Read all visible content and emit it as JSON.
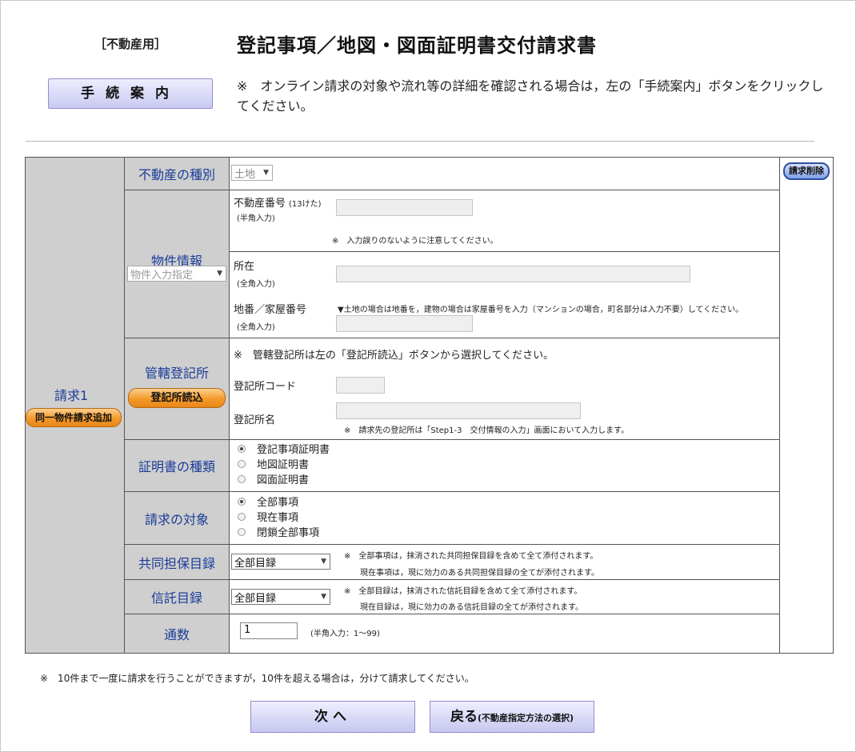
{
  "header": {
    "tag": "［不動産用］",
    "title": "登記事項／地図・図面証明書交付請求書",
    "guide_button": "手続案内",
    "guide_note": "※　オンライン請求の対象や流れ等の詳細を確認される場合は，左の「手続案内」ボタンをクリックしてください。"
  },
  "request": {
    "label": "請求1",
    "add_same_button": "同一物件請求追加",
    "delete_button": "請求削除"
  },
  "property_type": {
    "label": "不動産の種別",
    "selected": "土地"
  },
  "property_info": {
    "label": "物件情報",
    "mode_selected": "物件入力指定",
    "number_label": "不動産番号",
    "number_hint": "(13けた)",
    "number_sub": "(半角入力)",
    "number_value": "",
    "number_note": "※　入力誤りのないように注意してください。",
    "location_label": "所在",
    "location_sub": "(全角入力)",
    "location_value": "",
    "lot_label": "地番／家屋番号",
    "lot_sub": "(全角入力)",
    "lot_note": "▼土地の場合は地番を，建物の場合は家屋番号を入力（マンションの場合，町名部分は入力不要）してください。",
    "lot_value": ""
  },
  "registry_office": {
    "label": "管轄登記所",
    "read_button": "登記所読込",
    "note": "※　管轄登記所は左の「登記所読込」ボタンから選択してください。",
    "code_label": "登記所コード",
    "code_value": "",
    "name_label": "登記所名",
    "name_value": "",
    "name_note": "※　請求先の登記所は「Step1-3　交付情報の入力」画面において入力します。"
  },
  "certificate_type": {
    "label": "証明書の種類",
    "options": [
      "登記事項証明書",
      "地図証明書",
      "図面証明書"
    ],
    "selected_index": 0
  },
  "request_target": {
    "label": "請求の対象",
    "options": [
      "全部事項",
      "現在事項",
      "閉鎖全部事項"
    ],
    "selected_index": 0
  },
  "joint_collateral": {
    "label": "共同担保目録",
    "selected": "全部目録",
    "note1": "※　全部事項は，抹消された共同担保目録を含めて全て添付されます。",
    "note2": "現在事項は，現に効力のある共同担保目録の全てが添付されます。"
  },
  "trust_catalog": {
    "label": "信託目録",
    "selected": "全部目録",
    "note1": "※　全部目録は，抹消された信託目録を含めて全て添付されます。",
    "note2": "現在目録は，現に効力のある信託目録の全てが添付されます。"
  },
  "copies": {
    "label": "通数",
    "value": "1",
    "hint": "(半角入力：1～99)"
  },
  "footer": {
    "note": "※　10件まで一度に請求を行うことができますが，10件を超える場合は，分けて請求してください。",
    "next_button": "次へ",
    "back_button": "戻る",
    "back_sub": "(不動産指定方法の選択)"
  }
}
